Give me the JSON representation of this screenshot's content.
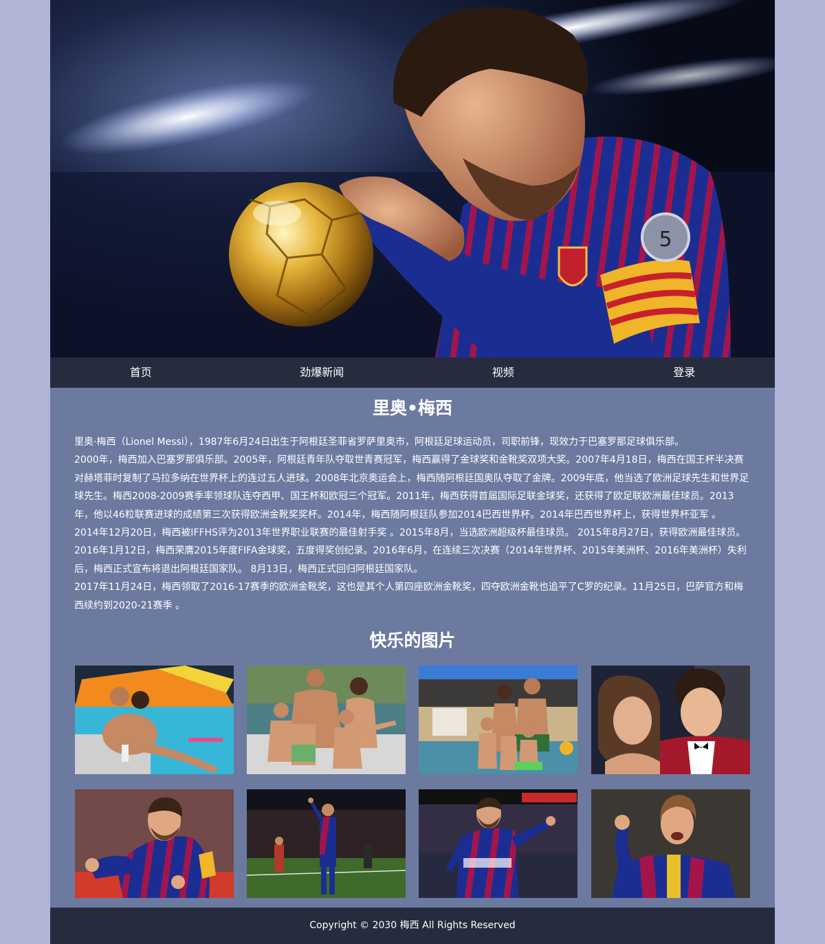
{
  "nav": {
    "items": [
      {
        "label": "首页"
      },
      {
        "label": "劲爆新闻"
      },
      {
        "label": "视频"
      },
      {
        "label": "登录"
      }
    ]
  },
  "main": {
    "title": "里奥•梅西",
    "paragraphs": [
      "里奥·梅西（Lionel Messi），1987年6月24日出生于阿根廷圣菲省罗萨里奥市，阿根廷足球运动员，司职前锋，现效力于巴塞罗那足球俱乐部。",
      "2000年，梅西加入巴塞罗那俱乐部。2005年，阿根廷青年队夺取世青赛冠军，梅西赢得了金球奖和金靴奖双项大奖。2007年4月18日，梅西在国王杯半决赛对赫塔菲时复制了马拉多纳在世界杯上的连过五人进球。2008年北京奥运会上，梅西随阿根廷国奥队夺取了金牌。2009年底，他当选了欧洲足球先生和世界足球先生。梅西2008-2009赛季率领球队连夺西甲、国王杯和欧冠三个冠军。2011年，梅西获得首届国际足联金球奖，还获得了欧足联欧洲最佳球员。2013年，他以46粒联赛进球的成绩第三次获得欧洲金靴奖奖杯。2014年，梅西随阿根廷队参加2014巴西世界杯。2014年巴西世界杯上，获得世界杯亚军 。",
      "2014年12月20日，梅西被IFFHS评为2013年世界职业联赛的最佳射手奖 。2015年8月，当选欧洲超级杯最佳球员。 2015年8月27日，获得欧洲最佳球员。  2016年1月12日，梅西荣膺2015年度FIFA金球奖，五度得奖创纪录。2016年6月，在连续三次决赛（2014年世界杯、2015年美洲杯、2016年美洲杯）失利后，梅西正式宣布将退出阿根廷国家队。  8月13日，梅西正式回归阿根廷国家队。",
      "2017年11月24日，梅西领取了2016-17赛季的欧洲金靴奖，这也是其个人第四座欧洲金靴奖，四夺欧洲金靴也追平了C罗的纪录。11月25日，巴萨官方和梅西续约到2020-21赛季  。"
    ],
    "photos_title": "快乐的图片"
  },
  "footer": {
    "text": "Copyright © 2030 梅西 All Rights Reserved"
  },
  "colors": {
    "page_bg": "#b1b4d6",
    "content_bg": "#6c7aa0",
    "nav_bg": "#262c3e",
    "text": "#ffffff"
  }
}
